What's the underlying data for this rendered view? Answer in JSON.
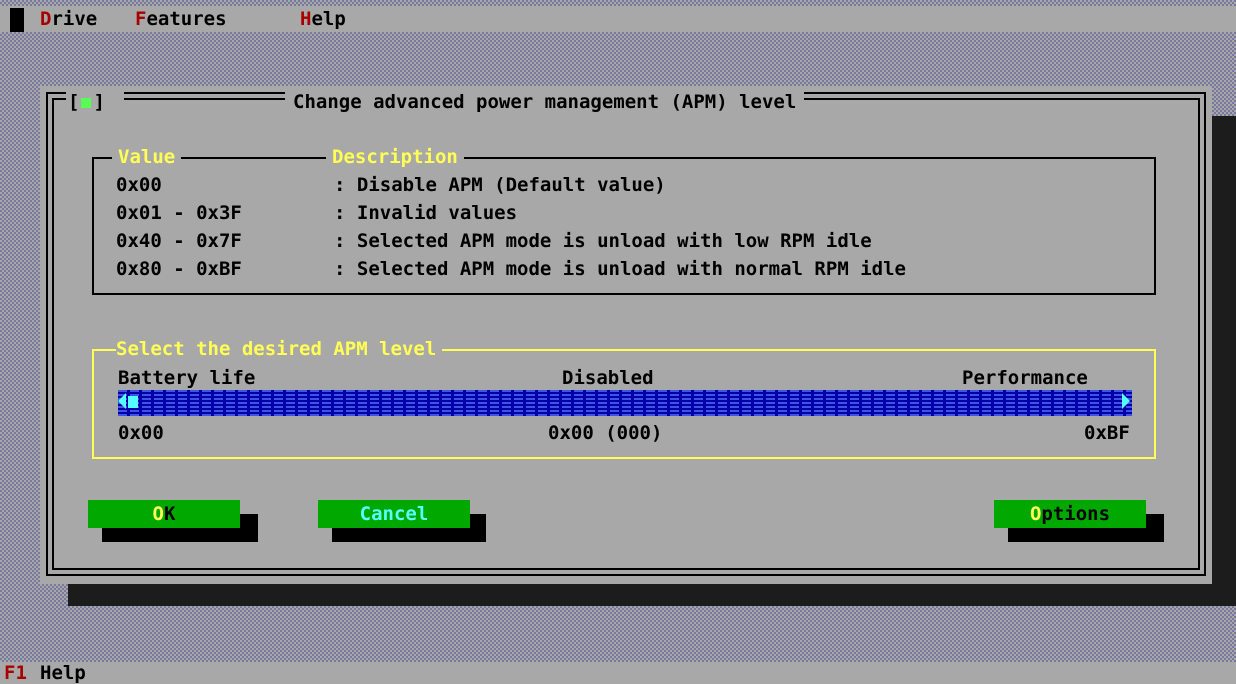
{
  "menu": {
    "items": [
      {
        "hotkey": "D",
        "rest": "rive"
      },
      {
        "hotkey": "F",
        "rest": "eatures"
      },
      {
        "hotkey": "H",
        "rest": "elp"
      }
    ]
  },
  "status": {
    "key": "F1",
    "label": "Help"
  },
  "dialog": {
    "close_left": "[",
    "close_right": "]",
    "title": "Change advanced power management (APM) level",
    "table": {
      "header_value": "Value",
      "header_description": "Description",
      "rows": [
        {
          "value": "0x00",
          "description": ": Disable APM (Default value)"
        },
        {
          "value": "0x01 - 0x3F",
          "description": ": Invalid values"
        },
        {
          "value": "0x40 - 0x7F",
          "description": ": Selected APM mode is unload with low RPM idle"
        },
        {
          "value": "0x80 - 0xBF",
          "description": ": Selected APM mode is unload with normal RPM idle"
        }
      ]
    },
    "slider": {
      "legend": "Select the desired APM level",
      "label_left": "Battery life",
      "label_center": "Disabled",
      "label_right": "Performance",
      "min_text": "0x00",
      "current_text": "0x00 (000)",
      "max_text": "0xBF",
      "value": 0,
      "max": 191
    },
    "buttons": {
      "ok": {
        "hotkey": "O",
        "rest": "K"
      },
      "cancel": {
        "label": "Cancel"
      },
      "options": {
        "hotkey": "O",
        "rest": "ptions"
      }
    }
  },
  "colors": {
    "desktop": "#a8a8a8",
    "hotkey_red": "#a80000",
    "legend_yellow": "#ffff55",
    "button_green": "#00a800",
    "track_blue": "#0000a8",
    "thumb_cyan": "#55ffff"
  }
}
